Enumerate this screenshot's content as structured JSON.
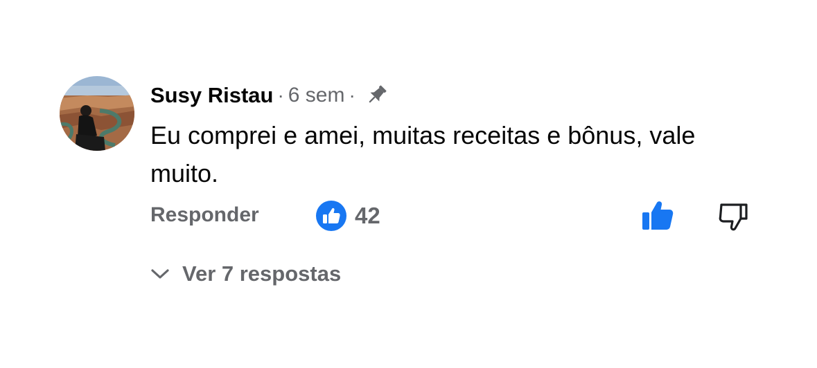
{
  "comment": {
    "author": "Susy Ristau",
    "separator_1": "·",
    "time": "6 sem",
    "separator_2": "·",
    "pin_icon": "pin-icon",
    "text": "Eu comprei e amei, muitas receitas e bônus, vale muito.",
    "reply_label": "Responder",
    "reaction_icon": "like-reaction-icon",
    "reaction_count": "42",
    "like_icon": "thumbs-up-icon",
    "dislike_icon": "thumbs-down-icon",
    "like_color": "#1877f2",
    "replies_label": "Ver 7 respostas",
    "replies_icon": "chevron-down-icon"
  }
}
